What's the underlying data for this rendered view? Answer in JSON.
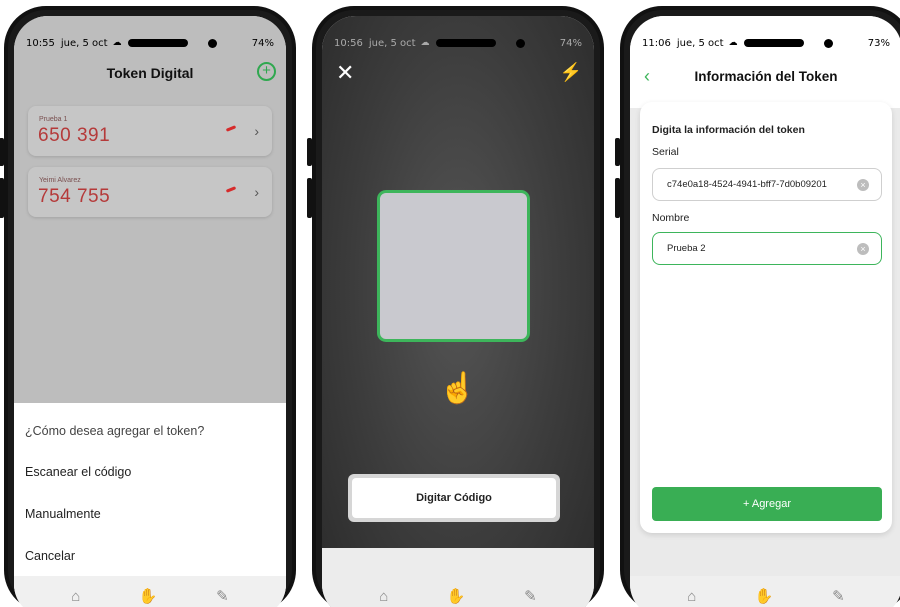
{
  "phone1": {
    "status": {
      "time": "10:55",
      "date": "jue, 5 oct",
      "battery": "74%"
    },
    "title": "Token Digital",
    "add_icon": "plus-circle-icon",
    "tokens": [
      {
        "name": "Prueba 1",
        "code": "650 391"
      },
      {
        "name": "Yeimi Alvarez",
        "code": "754 755"
      }
    ],
    "sheet": {
      "question": "¿Cómo desea agregar el token?",
      "options": [
        "Escanear el código",
        "Manualmente",
        "Cancelar"
      ]
    },
    "nav_icons": [
      "home-icon",
      "hand-coins-icon",
      "money-icon"
    ]
  },
  "phone2": {
    "status": {
      "time": "10:56",
      "date": "jue, 5 oct",
      "battery": "74%"
    },
    "close_icon": "close-icon",
    "flash_icon": "flash-off-icon",
    "hint_icon": "phone-scan-hand-icon",
    "button_label": "Digitar Código"
  },
  "phone3": {
    "status": {
      "time": "11:06",
      "date": "jue, 5 oct",
      "battery": "73%"
    },
    "title": "Información del Token",
    "section_title": "Digita la información del token",
    "serial_label": "Serial",
    "serial_value": "c74e0a18-4524-4941-bff7-7d0b09201",
    "name_label": "Nombre",
    "name_value": "Prueba 2",
    "add_button": "+ Agregar"
  },
  "colors": {
    "accent": "#3db55b",
    "token_code": "#b53a3a"
  }
}
